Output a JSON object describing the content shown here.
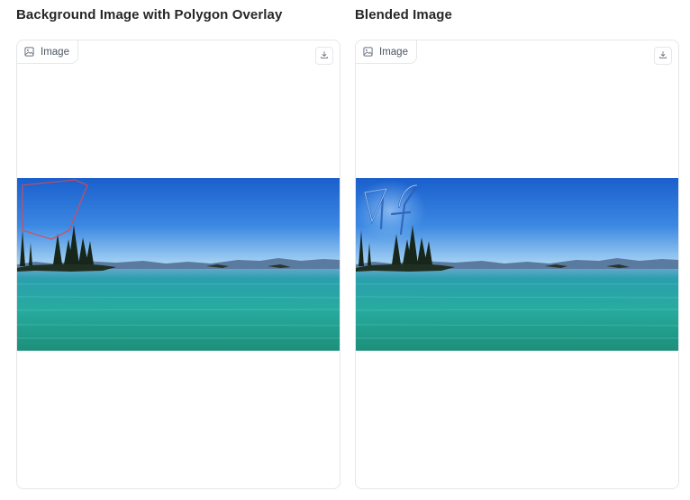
{
  "left_panel": {
    "title": "Background Image with Polygon Overlay",
    "label": "Image",
    "image_icon": "image-icon",
    "download_icon": "download-icon"
  },
  "right_panel": {
    "title": "Blended Image",
    "label": "Image",
    "image_icon": "image-icon",
    "download_icon": "download-icon"
  },
  "colors": {
    "polygon_stroke": "#d94a52",
    "sky_top": "#1a62d0",
    "sky_horizon": "#9fcff2",
    "water": "#25a7a6",
    "blend_glow": "#9ed4ff"
  }
}
